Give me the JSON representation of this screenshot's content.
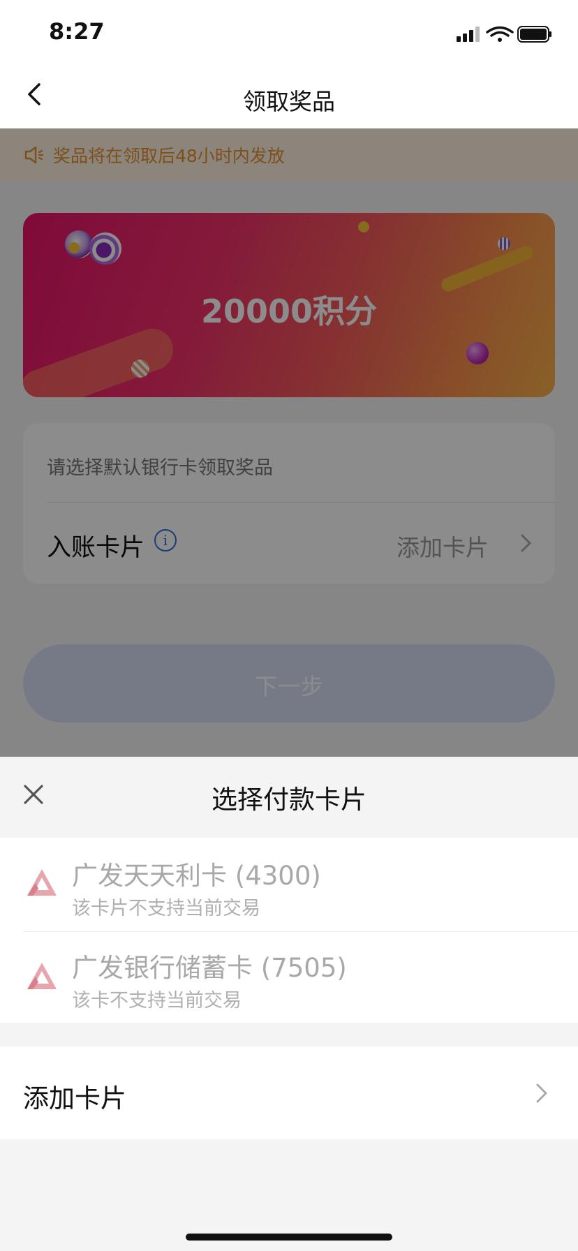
{
  "status_bar": {
    "time": "8:27"
  },
  "nav": {
    "title": "领取奖品"
  },
  "notice": {
    "text": "奖品将在领取后48小时内发放"
  },
  "banner": {
    "text": "20000积分"
  },
  "form": {
    "hint": "请选择默认银行卡领取奖品",
    "account_label": "入账卡片",
    "add_card": "添加卡片"
  },
  "next_button": {
    "label": "下一步"
  },
  "sheet": {
    "title": "选择付款卡片",
    "cards": [
      {
        "name": "广发天天利卡 (4300)",
        "note": "该卡片不支持当前交易"
      },
      {
        "name": "广发银行储蓄卡 (7505)",
        "note": "该卡不支持当前交易"
      }
    ],
    "add_card": "添加卡片"
  },
  "colors": {
    "accent": "#e5912e",
    "brand": "#e8136b",
    "link": "#2f6fd6"
  }
}
